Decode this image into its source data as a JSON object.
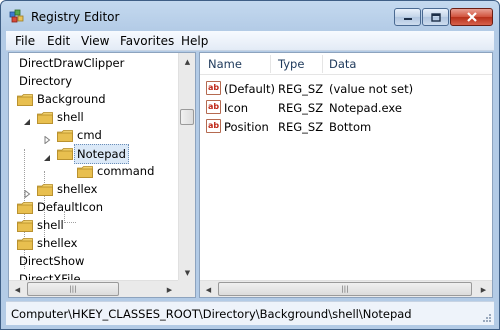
{
  "window": {
    "title": "Registry Editor",
    "minimize_glyph": "—",
    "maximize_glyph": "□",
    "close_glyph": "✕"
  },
  "menu": [
    "File",
    "Edit",
    "View",
    "Favorites",
    "Help"
  ],
  "tree": {
    "rows": [
      {
        "label": "DirectDrawClipper",
        "icon": "none",
        "expander": "none",
        "selected": false
      },
      {
        "label": "Directory",
        "icon": "none",
        "expander": "none",
        "selected": false
      },
      {
        "label": "Background",
        "icon": "folder-icon",
        "expander": "none",
        "selected": false
      },
      {
        "label": "shell",
        "icon": "folder-icon",
        "expander": "expanded",
        "selected": false
      },
      {
        "label": "cmd",
        "icon": "folder-icon",
        "expander": "collapsed",
        "selected": false
      },
      {
        "label": "Notepad",
        "icon": "folder-icon",
        "expander": "expanded",
        "selected": true
      },
      {
        "label": "command",
        "icon": "folder-icon",
        "expander": "none",
        "selected": false
      },
      {
        "label": "shellex",
        "icon": "folder-icon",
        "expander": "collapsed",
        "selected": false
      },
      {
        "label": "DefaultIcon",
        "icon": "folder-icon",
        "expander": "none",
        "selected": false
      },
      {
        "label": "shell",
        "icon": "folder-icon",
        "expander": "none",
        "selected": false
      },
      {
        "label": "shellex",
        "icon": "folder-icon",
        "expander": "none",
        "selected": false
      },
      {
        "label": "DirectShow",
        "icon": "none",
        "expander": "none",
        "selected": false
      },
      {
        "label": "DirectXFile",
        "icon": "none",
        "expander": "none",
        "selected": false
      }
    ],
    "scroll_up": "▲",
    "scroll_down": "▼",
    "scroll_left": "◀",
    "scroll_right": "▶"
  },
  "values": {
    "headers": {
      "name": "Name",
      "type": "Type",
      "data": "Data"
    },
    "rows": [
      {
        "icon": "ab",
        "name": "(Default)",
        "type": "REG_SZ",
        "data": "(value not set)"
      },
      {
        "icon": "ab",
        "name": "Icon",
        "type": "REG_SZ",
        "data": "Notepad.exe"
      },
      {
        "icon": "ab",
        "name": "Position",
        "type": "REG_SZ",
        "data": "Bottom"
      }
    ]
  },
  "status": {
    "path": "Computer\\HKEY_CLASSES_ROOT\\Directory\\Background\\shell\\Notepad"
  },
  "colors": {
    "title_bar": "#b3cbe6",
    "close_button": "#c7432c",
    "folder": "#e8c25a",
    "selection": "#dbe9f8"
  }
}
